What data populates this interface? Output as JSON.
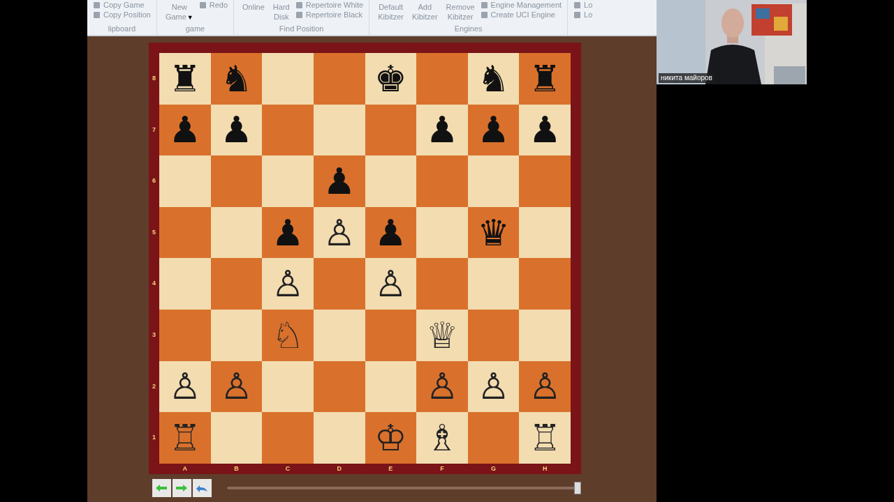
{
  "ribbon": {
    "groups": [
      {
        "label": "lipboard",
        "items": [
          {
            "kind": "small",
            "label": "Copy Game"
          },
          {
            "kind": "small",
            "label": "Copy Position"
          }
        ]
      },
      {
        "label": "game",
        "items": [
          {
            "kind": "large",
            "label": "New Game",
            "caret": "▼"
          },
          {
            "kind": "small",
            "label": "Redo"
          }
        ]
      },
      {
        "label": "Find Position",
        "items": [
          {
            "kind": "large",
            "label": "Online"
          },
          {
            "kind": "large",
            "label": "Hard Disk"
          },
          {
            "kind": "small",
            "label": "Repertoire White"
          },
          {
            "kind": "small",
            "label": "Repertoire Black"
          }
        ]
      },
      {
        "label": "Engines",
        "items": [
          {
            "kind": "large",
            "label": "Default Kibitzer"
          },
          {
            "kind": "large",
            "label": "Add Kibitzer"
          },
          {
            "kind": "large",
            "label": "Remove Kibitzer"
          },
          {
            "kind": "small",
            "label": "Engine Management"
          },
          {
            "kind": "small",
            "label": "Create UCI Engine"
          }
        ]
      },
      {
        "items": [
          {
            "kind": "small",
            "label": "Lo"
          },
          {
            "kind": "small",
            "label": "Lo"
          }
        ]
      }
    ]
  },
  "board": {
    "ranks": [
      {
        "label": "8",
        "cells": [
          "♜",
          "♞",
          null,
          null,
          "♚",
          null,
          "♞",
          "♜"
        ]
      },
      {
        "label": "7",
        "cells": [
          "♟",
          "♟",
          null,
          null,
          null,
          "♟",
          "♟",
          "♟"
        ]
      },
      {
        "label": "6",
        "cells": [
          null,
          null,
          null,
          "♟",
          null,
          null,
          null,
          null
        ]
      },
      {
        "label": "5",
        "cells": [
          null,
          null,
          "♟",
          "♙",
          "♟",
          null,
          "♛",
          null
        ]
      },
      {
        "label": "4",
        "cells": [
          null,
          null,
          "♙",
          null,
          "♙",
          null,
          null,
          null
        ]
      },
      {
        "label": "3",
        "cells": [
          null,
          null,
          "♘",
          null,
          null,
          "♕",
          null,
          null
        ]
      },
      {
        "label": "2",
        "cells": [
          "♙",
          "♙",
          null,
          null,
          null,
          "♙",
          "♙",
          "♙"
        ]
      },
      {
        "label": "1",
        "cells": [
          "♖",
          null,
          null,
          null,
          "♔",
          "♗",
          null,
          "♖"
        ]
      }
    ],
    "files": [
      "A",
      "B",
      "C",
      "D",
      "E",
      "F",
      "G",
      "H"
    ]
  },
  "navigation": {
    "slider": {
      "level": 1
    }
  },
  "video": {
    "name": "никита майоров"
  }
}
